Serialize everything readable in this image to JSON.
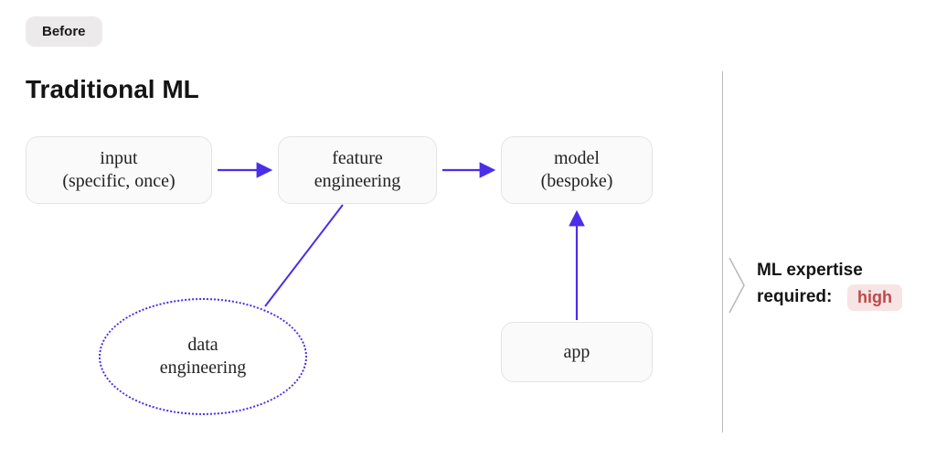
{
  "badge": "Before",
  "title": "Traditional ML",
  "boxes": {
    "input": "input\n(specific, once)",
    "feature": "feature\nengineering",
    "model": "model\n(bespoke)",
    "app": "app",
    "data_eng": "data\nengineering"
  },
  "summary": {
    "label": "ML expertise\nrequired:",
    "value": "high"
  },
  "colors": {
    "arrow": "#4a2eea",
    "dotted": "#4a2eea",
    "badge_bg": "#eceaea",
    "value_bg": "#f7e4e4",
    "value_fg": "#c04848"
  }
}
